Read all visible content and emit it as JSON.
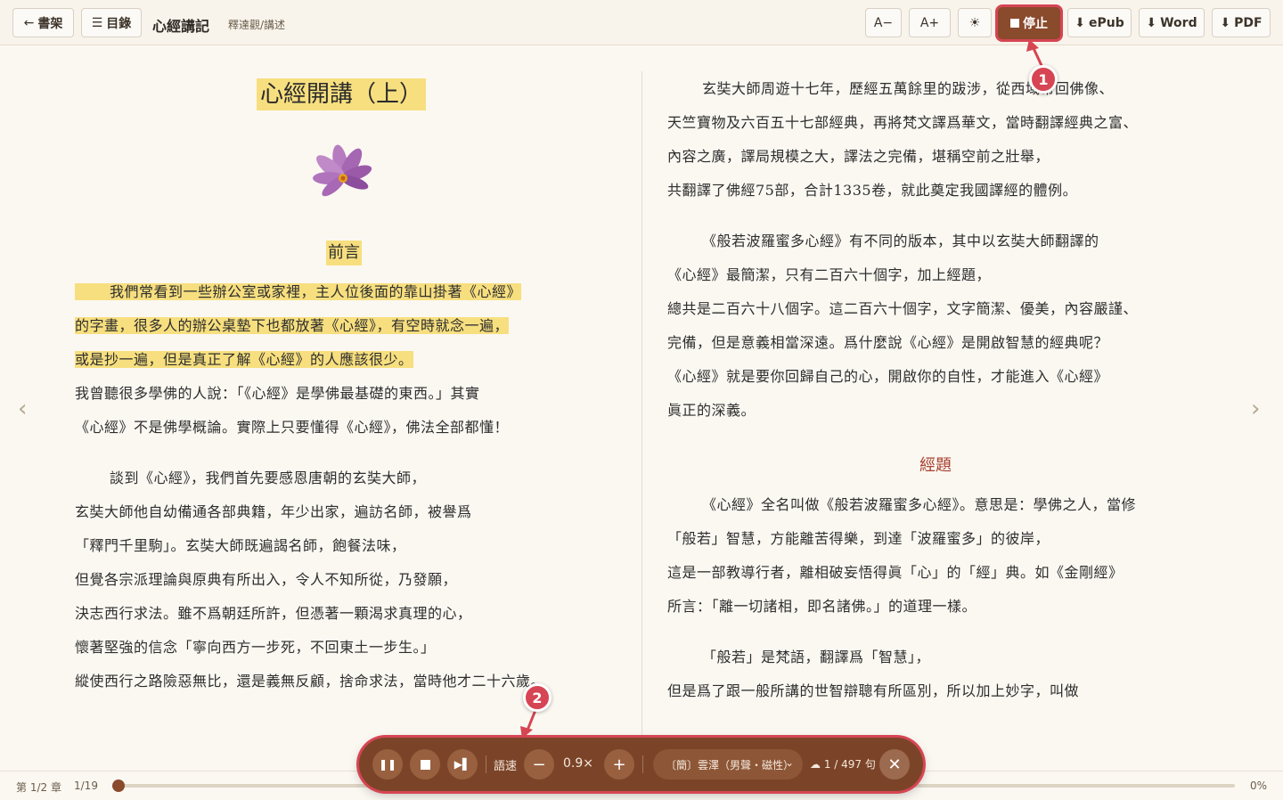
{
  "toolbar": {
    "back_label": "書架",
    "toc_label": "目錄",
    "book_title": "心經講記",
    "author": "釋達觀/講述",
    "font_smaller": "A−",
    "font_larger": "A+",
    "stop_label": "停止",
    "epub_label": "ePub",
    "word_label": "Word",
    "pdf_label": "PDF"
  },
  "left_page": {
    "chapter_title": "心經開講（上）",
    "section_title": "前言",
    "lines": [
      "我們常看到一些辦公室或家裡，主人位後面的靠山掛著《心經》",
      "的字畫，很多人的辦公桌墊下也都放著《心經》，有空時就念一遍，",
      "或是抄一遍，但是真正了解《心經》的人應該很少。",
      "我曾聽很多學佛的人說：「《心經》是學佛最基礎的東西。」其實",
      "《心經》不是佛學概論。實際上只要懂得《心經》，佛法全部都懂！",
      "談到《心經》，我們首先要感恩唐朝的玄奘大師，",
      "玄奘大師他自幼備通各部典籍，年少出家，遍訪名師，被譽爲",
      "「釋門千里駒」。玄奘大師既遍謁名師，飽餐法味，",
      "但覺各宗派理論與原典有所出入，令人不知所從，乃發願，",
      "決志西行求法。雖不爲朝廷所許，但憑著一顆渴求真理的心，",
      "懷著堅強的信念「寧向西方一步死，不回東土一步生。」",
      "縱使西行之路險惡無比，還是義無反顧，捨命求法，當時他才二十六歲。"
    ]
  },
  "right_page": {
    "lines": [
      "玄奘大師周遊十七年，歷經五萬餘里的跋涉，從西域帶回佛像、",
      "天竺寶物及六百五十七部經典，再將梵文譯爲華文，當時翻譯經典之富、",
      "內容之廣，譯局規模之大，譯法之完備，堪稱空前之壯舉，",
      "共翻譯了佛經75部，合計1335卷，就此奠定我國譯經的體例。",
      "《般若波羅蜜多心經》有不同的版本，其中以玄奘大師翻譯的",
      "《心經》最簡潔，只有二百六十個字，加上經題，",
      "總共是二百六十八個字。這二百六十個字，文字簡潔、優美，內容嚴謹、",
      "完備，但是意義相當深遠。爲什麼說《心經》是開啟智慧的經典呢？",
      "《心經》就是要你回歸自己的心，開啟你的自性，才能進入《心經》",
      "眞正的深義。",
      "《心經》全名叫做《般若波羅蜜多心經》。意思是：學佛之人，當修",
      "「般若」智慧，方能離苦得樂，到達「波羅蜜多」的彼岸，",
      "這是一部教導行者，離相破妄悟得眞「心」的「經」典。如《金剛經》",
      "所言：「離一切諸相，即名諸佛。」的道理一樣。",
      "「般若」是梵語，翻譯爲「智慧」，",
      "但是爲了跟一般所講的世智辯聰有所區別，所以加上妙字，叫做"
    ],
    "section_title": "經題"
  },
  "progress": {
    "chapter": "第 1/2 章",
    "page": "1/19",
    "percent": "0%",
    "fraction": 0.0
  },
  "player": {
    "speed_label": "語速",
    "speed_value": "0.9×",
    "voice": "〔簡〕雲澤（男聲・磁性）",
    "sentence_count": "1 / 497 句"
  },
  "markers": [
    "1",
    "2"
  ],
  "colors": {
    "accent": "#8a4a2c",
    "highlight": "#f7df7f",
    "annotation": "#d64553",
    "section_red": "#a84030"
  }
}
